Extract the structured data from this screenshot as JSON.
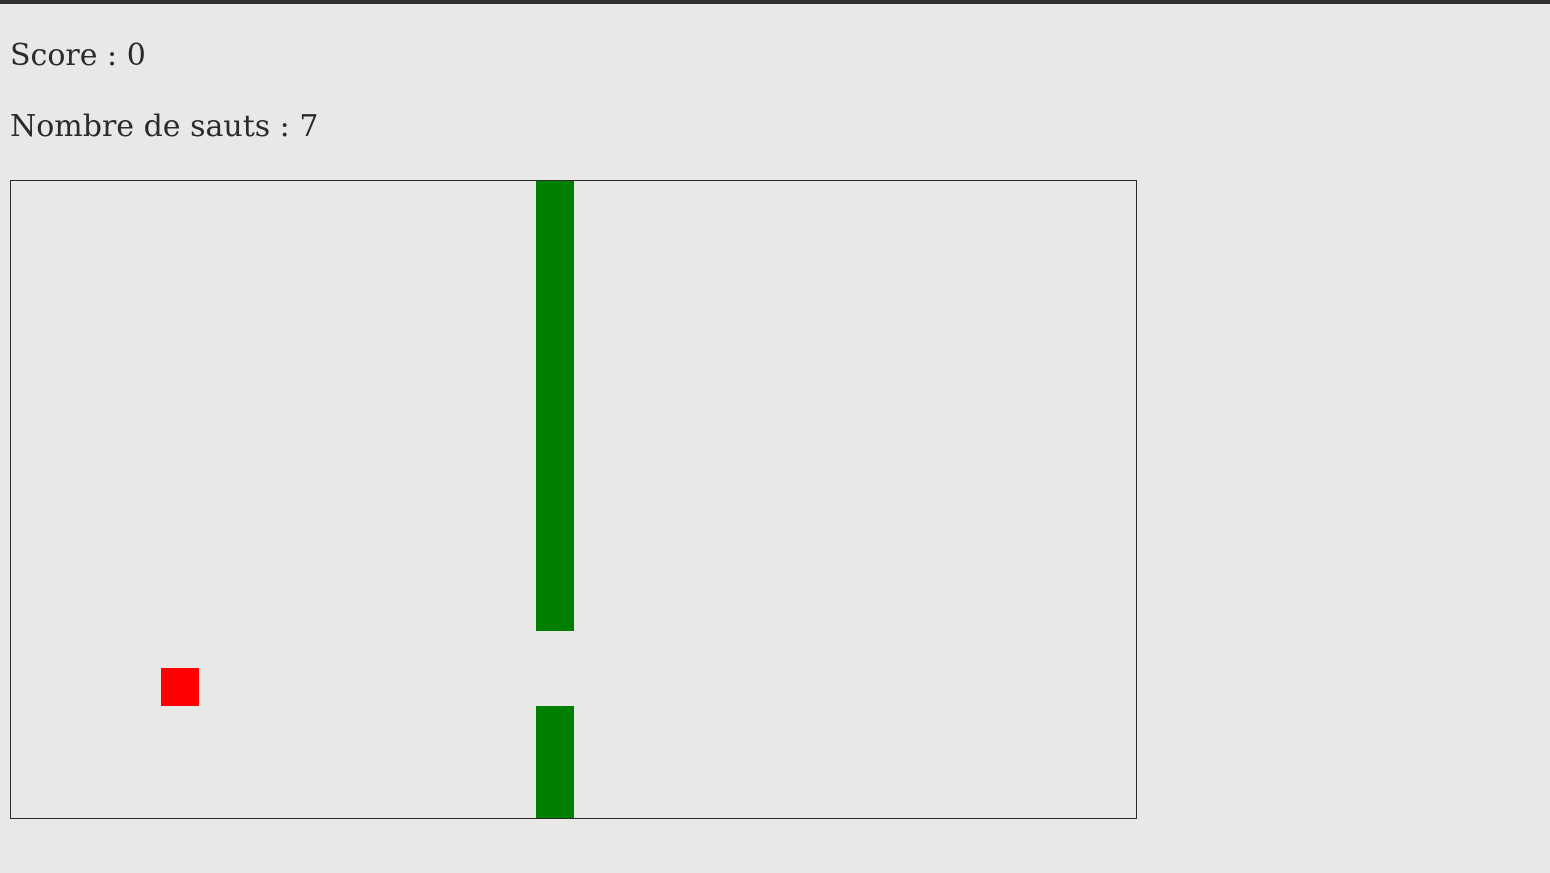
{
  "hud": {
    "score_text": "Score : 0",
    "jumps_text": "Nombre de sauts : 7",
    "score": 0,
    "jumps": 7
  },
  "colors": {
    "background": "#e8e8e6",
    "pipe": "#008000",
    "player": "#ff0000",
    "text": "#2b2b2b",
    "border": "#2b2b2b"
  }
}
